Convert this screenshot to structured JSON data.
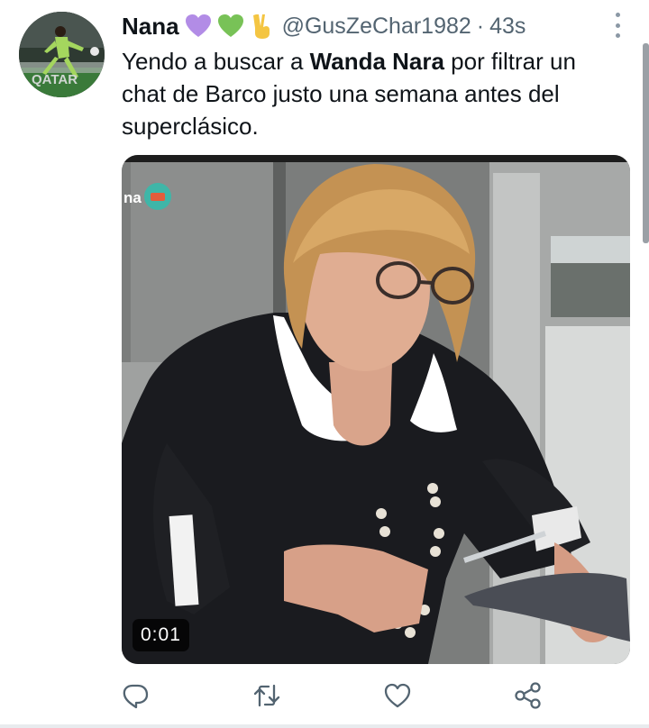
{
  "tweet": {
    "display_name": "Nana",
    "emoji": [
      "purple-heart",
      "green-heart",
      "victory-hand"
    ],
    "handle": "@GusZeChar1982",
    "separator": "·",
    "time": "43s",
    "text": {
      "part1": "Yendo a buscar a ",
      "bold": "Wanda Nara",
      "part2": " por filtrar un chat de Barco justo una semana antes del superclásico."
    },
    "avatar_caption": "QATAR",
    "media": {
      "type": "video",
      "duration": "0:01",
      "overlay_fragment": "na"
    }
  },
  "actions": [
    "reply-icon",
    "retweet-icon",
    "like-icon",
    "share-icon"
  ],
  "colors": {
    "text": "#0f1419",
    "secondary": "#536471",
    "icon": "#536471",
    "purple_heart": "#b28ce6",
    "green_heart": "#78c257",
    "pitch_green": "#3a7a3a"
  }
}
